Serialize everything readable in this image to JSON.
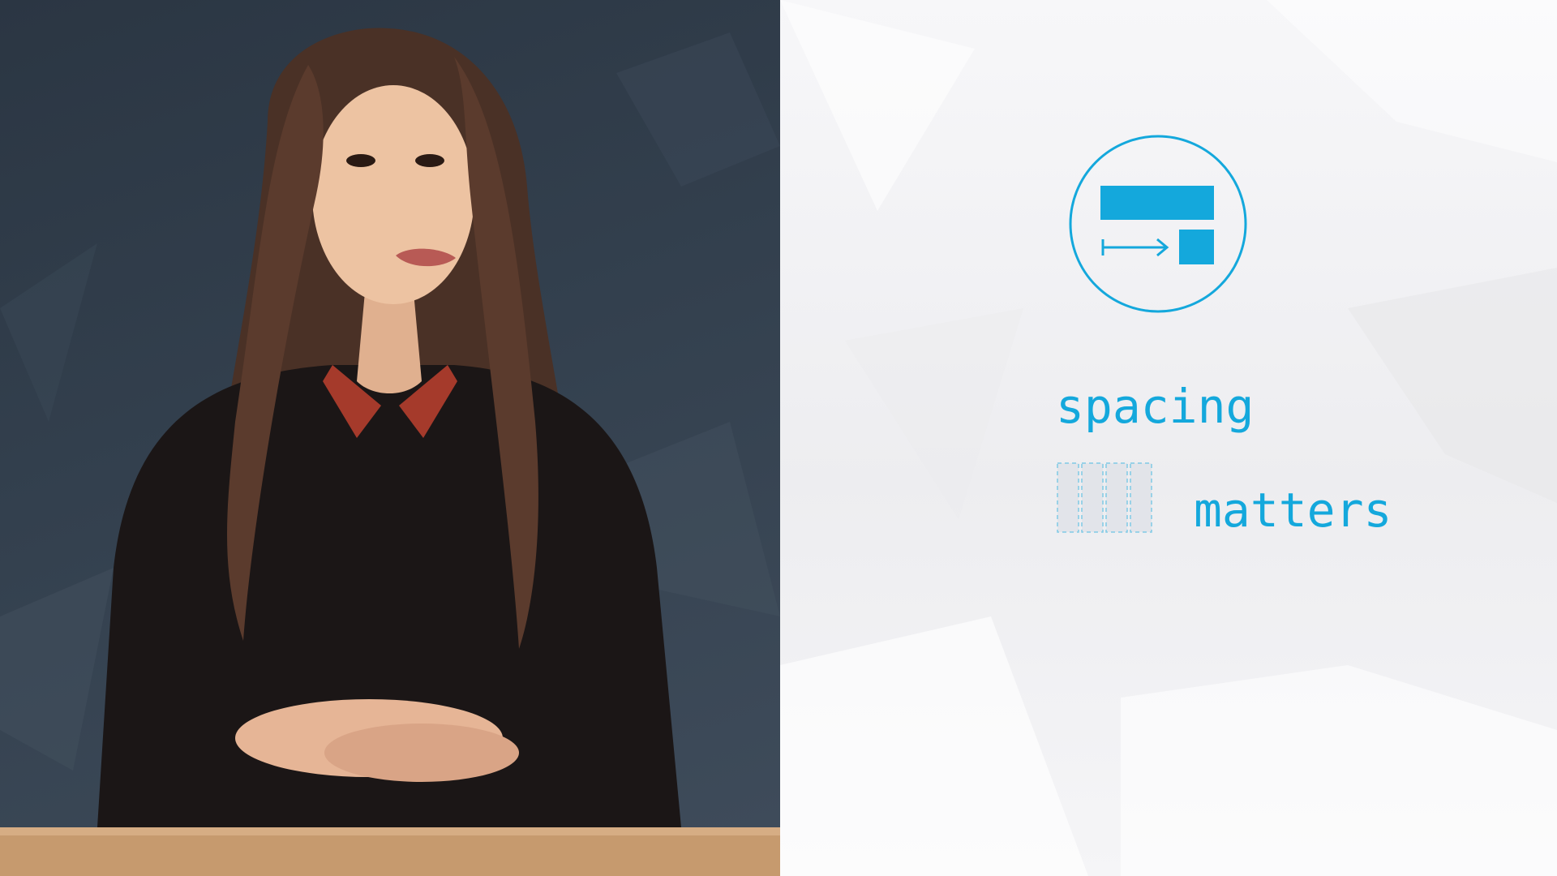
{
  "slide": {
    "word_1": "spacing",
    "word_2": "matters"
  },
  "colors": {
    "accent": "#14a8dc",
    "video_background": "#33404e",
    "slide_background": "#f0f0f2"
  },
  "icons": {
    "spacing_icon": "spacing-indent-icon"
  }
}
